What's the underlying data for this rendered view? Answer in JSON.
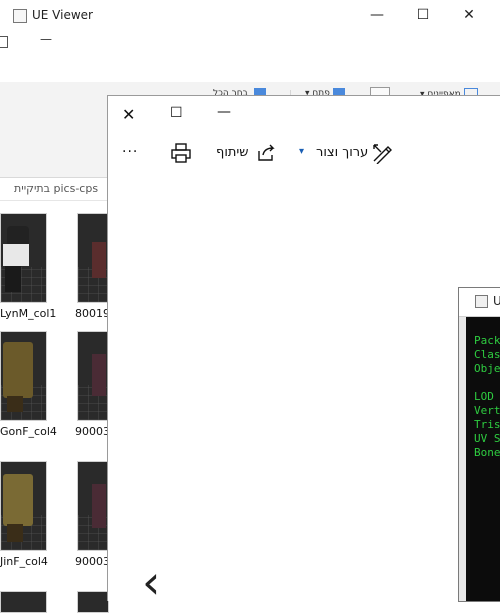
{
  "ue_window": {
    "title": "UE Viewer",
    "minimize": "—",
    "maximize": "☐",
    "close": "✕"
  },
  "explorer": {
    "top_minimize": "—",
    "ribbon": {
      "item1": "בחר הכל",
      "item2": "פתח",
      "item3": "מאפיינים"
    },
    "address_path": "בתיקיית pics-cps",
    "thumbnails": [
      {
        "label": "LynM_col1"
      },
      {
        "label": "80019_"
      },
      {
        "label": "GonF_col4"
      },
      {
        "label": "90003_"
      },
      {
        "label": "JinF_col4"
      },
      {
        "label": "90003"
      }
    ]
  },
  "photos": {
    "close": "✕",
    "maximize": "☐",
    "minimize": "—",
    "more": "···",
    "share_label": "שיתוף",
    "edit_label": "ערוך וצור",
    "prev_arrow": "‹"
  },
  "terminal": {
    "title_char": "U",
    "lines": [
      "Pack",
      "Clas",
      "Obje",
      "",
      "LOD",
      "Vert",
      "Tris",
      "UV S",
      "Bone"
    ]
  },
  "colors": {
    "terminal_text": "#2ecc40",
    "terminal_bg": "#0c0c0c"
  }
}
